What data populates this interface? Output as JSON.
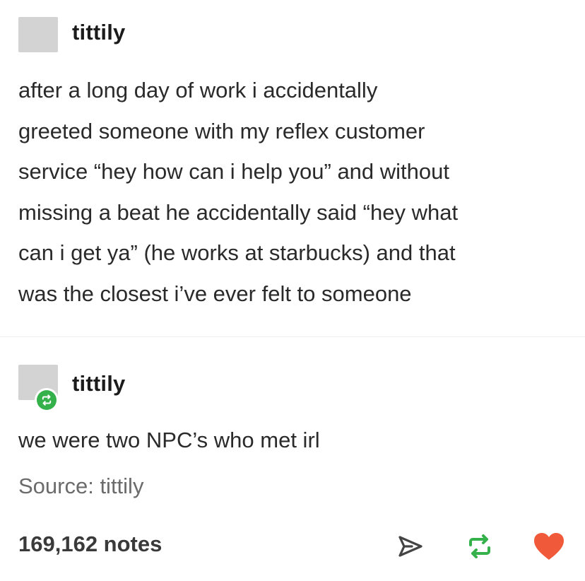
{
  "original_post": {
    "username": "tittily",
    "text_lines": [
      "after a long day of work i accidentally",
      "greeted someone with my reflex customer",
      "service “hey how can i help you” and without",
      "missing a beat he accidentally said “hey what",
      "can i get ya” (he works at starbucks) and that",
      "was the closest i’ve ever felt to someone"
    ]
  },
  "reblog": {
    "username": "tittily",
    "text": "we were two NPC’s who met irl",
    "badge_icon": "reblog-icon",
    "badge_color": "#35b14b"
  },
  "footer": {
    "source": "Source: tittily",
    "notes": "169,162 notes",
    "actions": [
      {
        "name": "share",
        "icon": "paper-plane-icon"
      },
      {
        "name": "reblog",
        "icon": "reblog-icon",
        "color": "#35b14b"
      },
      {
        "name": "like",
        "icon": "heart-icon",
        "color": "#f05a3a"
      }
    ]
  }
}
